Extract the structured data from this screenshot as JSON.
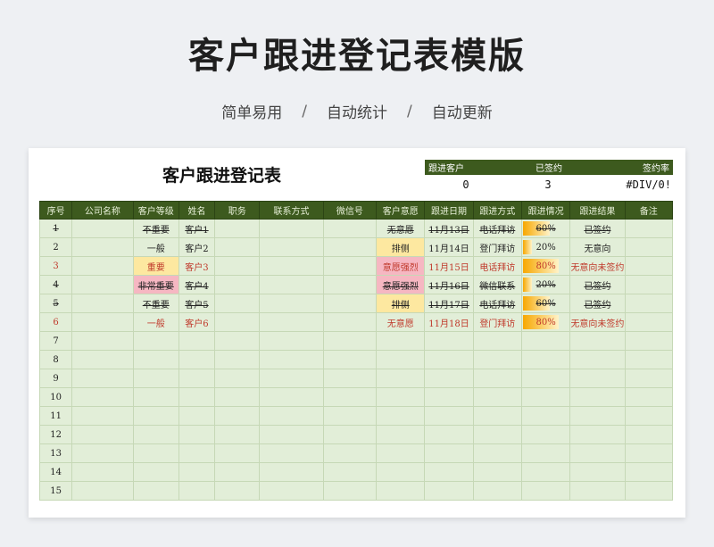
{
  "title": "客户跟进登记表模版",
  "tags": [
    "简单易用",
    "自动统计",
    "自动更新"
  ],
  "separator": "/",
  "sheet": {
    "title": "客户跟进登记表",
    "summary": {
      "headers": [
        "跟进客户",
        "已签约",
        "签约率"
      ],
      "values": [
        "0",
        "3",
        "#DIV/0!"
      ]
    },
    "columns": [
      "序号",
      "公司名称",
      "客户等级",
      "姓名",
      "职务",
      "联系方式",
      "微信号",
      "客户意愿",
      "跟进日期",
      "跟进方式",
      "跟进情况",
      "跟进结果",
      "备注"
    ],
    "rows": [
      {
        "no": "1",
        "company": "",
        "level": "不重要",
        "name": "客户1",
        "title": "",
        "contact": "",
        "wechat": "",
        "intent": "无意愿",
        "date": "11月13日",
        "method": "电话拜访",
        "progress": "60%",
        "progress_value": 0.6,
        "result": "已签约",
        "note": "",
        "style": "done",
        "level_bg": "",
        "intent_bg": ""
      },
      {
        "no": "2",
        "company": "",
        "level": "一般",
        "name": "客户2",
        "title": "",
        "contact": "",
        "wechat": "",
        "intent": "排侧",
        "date": "11月14日",
        "method": "登门拜访",
        "progress": "20%",
        "progress_value": 0.2,
        "result": "无意向",
        "note": "",
        "style": "",
        "level_bg": "",
        "intent_bg": "yellow"
      },
      {
        "no": "3",
        "company": "",
        "level": "重要",
        "name": "客户3",
        "title": "",
        "contact": "",
        "wechat": "",
        "intent": "意愿强烈",
        "date": "11月15日",
        "method": "电话拜访",
        "progress": "80%",
        "progress_value": 0.8,
        "result": "无意向未签约",
        "note": "",
        "style": "red",
        "level_bg": "yellow",
        "intent_bg": "pink"
      },
      {
        "no": "4",
        "company": "",
        "level": "非常重要",
        "name": "客户4",
        "title": "",
        "contact": "",
        "wechat": "",
        "intent": "意愿强烈",
        "date": "11月16日",
        "method": "微信联系",
        "progress": "20%",
        "progress_value": 0.2,
        "result": "已签约",
        "note": "",
        "style": "done",
        "level_bg": "pink",
        "intent_bg": "pink"
      },
      {
        "no": "5",
        "company": "",
        "level": "不重要",
        "name": "客户5",
        "title": "",
        "contact": "",
        "wechat": "",
        "intent": "排侧",
        "date": "11月17日",
        "method": "电话拜访",
        "progress": "60%",
        "progress_value": 0.6,
        "result": "已签约",
        "note": "",
        "style": "done",
        "level_bg": "",
        "intent_bg": "yellow"
      },
      {
        "no": "6",
        "company": "",
        "level": "一般",
        "name": "客户6",
        "title": "",
        "contact": "",
        "wechat": "",
        "intent": "无意愿",
        "date": "11月18日",
        "method": "登门拜访",
        "progress": "80%",
        "progress_value": 0.8,
        "result": "无意向未签约",
        "note": "",
        "style": "red",
        "level_bg": "",
        "intent_bg": ""
      },
      {
        "no": "7"
      },
      {
        "no": "8"
      },
      {
        "no": "9"
      },
      {
        "no": "10"
      },
      {
        "no": "11"
      },
      {
        "no": "12"
      },
      {
        "no": "13"
      },
      {
        "no": "14"
      },
      {
        "no": "15"
      }
    ]
  }
}
